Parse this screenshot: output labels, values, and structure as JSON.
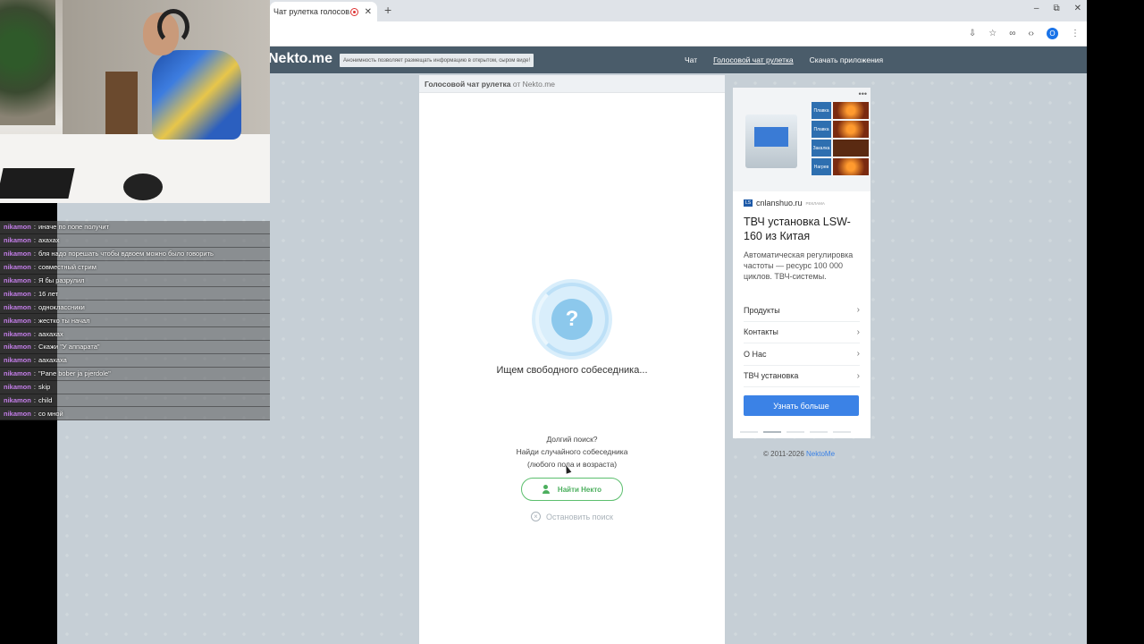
{
  "browser": {
    "tab_title": "Чат рулетка голосов...",
    "tab_close": "✕",
    "new_tab": "+",
    "win_min": "–",
    "win_max": "⧉",
    "win_close": "✕",
    "profile_initial": "O"
  },
  "site": {
    "logo": "Nekto.me",
    "anon_notice": "Анонимность позволяет размещать информацию в открытом, сыром виде!",
    "nav": {
      "chat": "Чат",
      "voice_roulette": "Голосовой чат рулетка",
      "download": "Скачать приложения"
    }
  },
  "panel": {
    "header_bold": "Голосовой чат рулетка",
    "header_rest": " от Nekto.me",
    "question_mark": "?",
    "searching_text": "Ищем свободного собеседника...",
    "long_search_title": "Долгий поиск?",
    "long_search_line2": "Найди случайного собеседника",
    "long_search_line3": "(любого пола и возраста)",
    "find_button": "Найти Некто",
    "stop_search": "Остановить поиск"
  },
  "ad": {
    "more": "•••",
    "steps": [
      "Плавка",
      "Плавка",
      "Закалка",
      "Нагрев"
    ],
    "logo_text": "LS",
    "domain": "cnlanshuo.ru",
    "ad_label": "РЕКЛАМА",
    "title": "ТВЧ установка LSW-160 из Китая",
    "description": "Автоматическая регулировка частоты — ресурс 100 000 циклов. ТВЧ-системы.",
    "links": [
      "Продукты",
      "Контакты",
      "О Нас",
      "ТВЧ установка"
    ],
    "chevron": "›",
    "button": "Узнать больше"
  },
  "footer": {
    "copyright": "© 2011-2026 ",
    "brand": "NektoMe"
  },
  "stream_chat": {
    "messages": [
      {
        "user": "nikamon",
        "text": "иначе по попе получит"
      },
      {
        "user": "nikamon",
        "text": "ахахах"
      },
      {
        "user": "nikamon",
        "text": "бля надо порешать чтобы вдвоем можно было говорить"
      },
      {
        "user": "nikamon",
        "text": "совместный стрим"
      },
      {
        "user": "nikamon",
        "text": "Я бы разрулил"
      },
      {
        "user": "nikamon",
        "text": "16 лет"
      },
      {
        "user": "nikamon",
        "text": "одноклассники"
      },
      {
        "user": "nikamon",
        "text": "жестко ты начал"
      },
      {
        "user": "nikamon",
        "text": "аахахах"
      },
      {
        "user": "nikamon",
        "text": "Скажи \"У аппарата\""
      },
      {
        "user": "nikamon",
        "text": "аахахаха"
      },
      {
        "user": "nikamon",
        "text": "\"Pane bober ja pjerdole\""
      },
      {
        "user": "nikamon",
        "text": "skip"
      },
      {
        "user": "nikamon",
        "text": "child"
      },
      {
        "user": "nikamon",
        "text": "со мной"
      }
    ]
  }
}
